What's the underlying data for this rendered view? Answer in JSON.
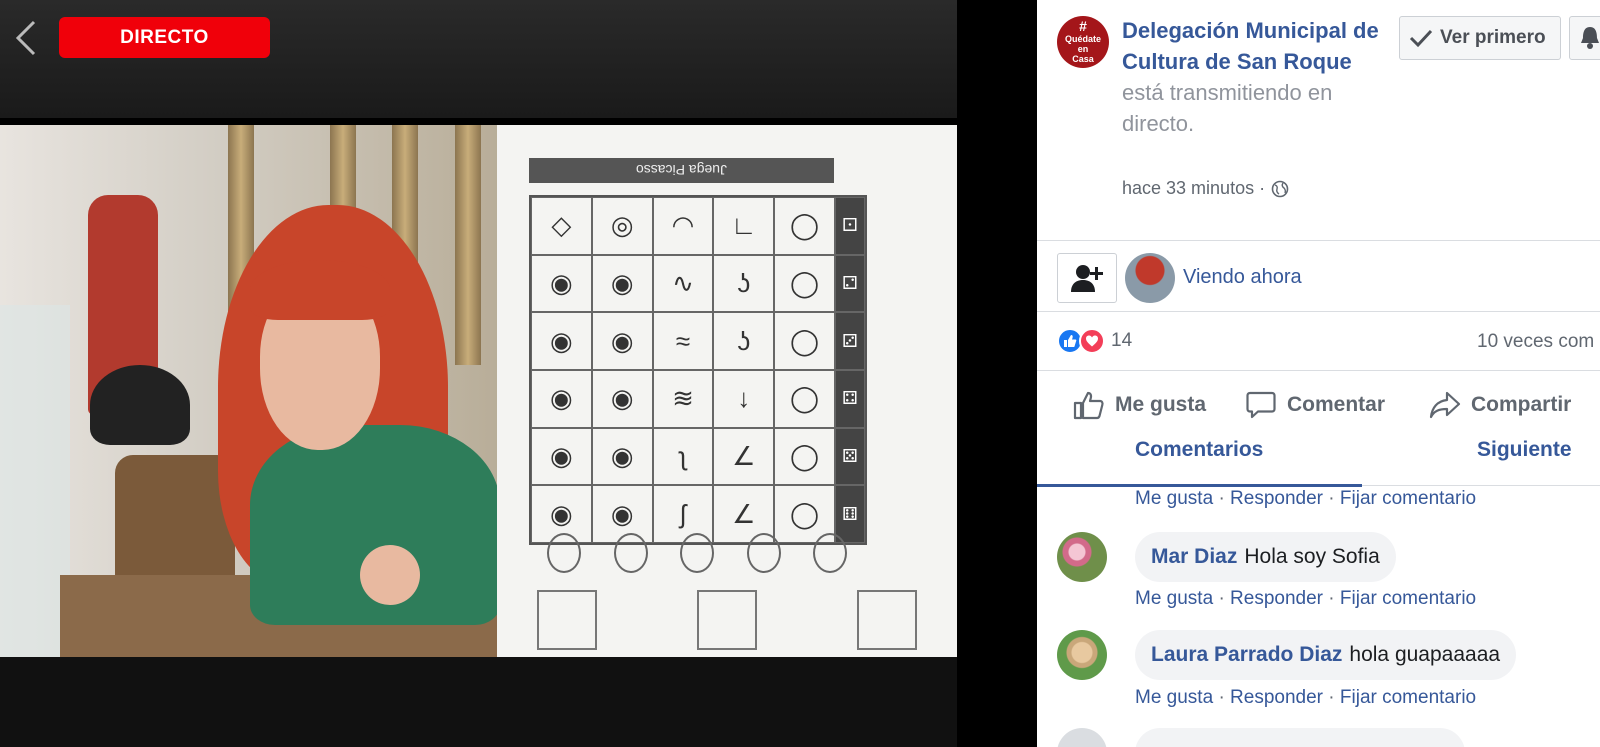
{
  "video": {
    "live_label": "DIRECTO",
    "sheet_title": "Juega Picasso",
    "back_icon": "chevron-left-icon"
  },
  "post": {
    "page_avatar_text_1": "#",
    "page_avatar_text_2": "Quédate",
    "page_avatar_text_3": "en",
    "page_avatar_text_4": "Casa",
    "page_name": "Delegación Municipal de Cultura de San Roque",
    "status_text": " está transmitiendo en directo.",
    "timestamp": "hace 33 minutos ·",
    "see_first_label": "Ver primero"
  },
  "viewers": {
    "viewing_now_label": "Viendo ahora"
  },
  "stats": {
    "reaction_count": "14",
    "shares_text": "10 veces com"
  },
  "actions": {
    "like_label": "Me gusta",
    "comment_label": "Comentar",
    "share_label": "Compartir"
  },
  "tabs": {
    "comments": "Comentarios",
    "next": "Siguiente"
  },
  "comment_actions": {
    "like": "Me gusta",
    "reply": "Responder",
    "pin": "Fijar comentario",
    "separator": "·"
  },
  "comments": [
    {
      "author": "Mar Diaz",
      "text": "Hola soy Sofia"
    },
    {
      "author": "Laura Parrado Diaz",
      "text": "hola guapaaaaa"
    }
  ],
  "colors": {
    "live_red": "#f0000a",
    "link_blue": "#365899",
    "page_red": "#a4161a"
  }
}
